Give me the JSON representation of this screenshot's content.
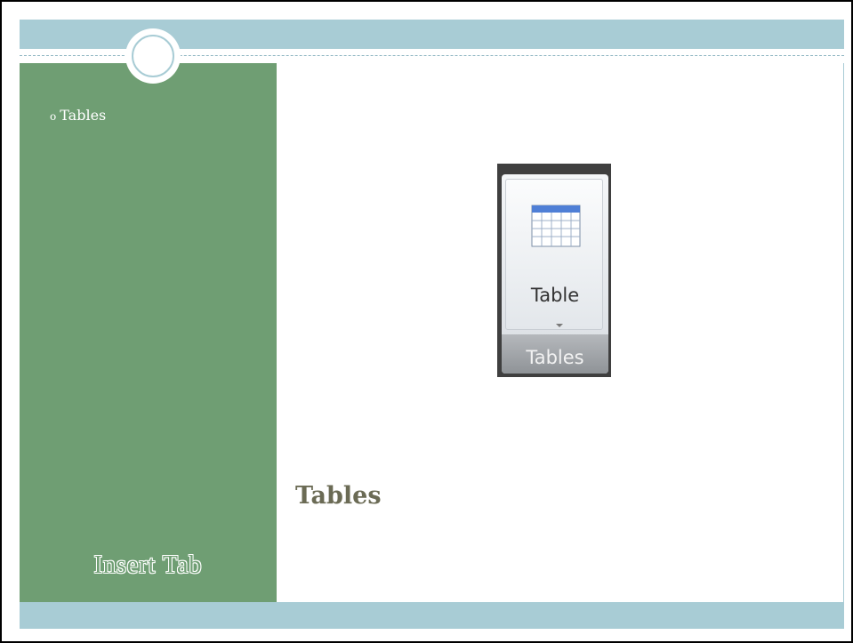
{
  "slide": {
    "bullet_items": [
      "Tables"
    ],
    "side_title": "Insert Tab",
    "content_heading": "Tables"
  },
  "ribbon": {
    "button_label": "Table",
    "group_label": "Tables",
    "icon": "table-grid-icon"
  },
  "colors": {
    "band": "#a8ccd5",
    "side_panel": "#6f9e73",
    "heading": "#6b6b55"
  }
}
